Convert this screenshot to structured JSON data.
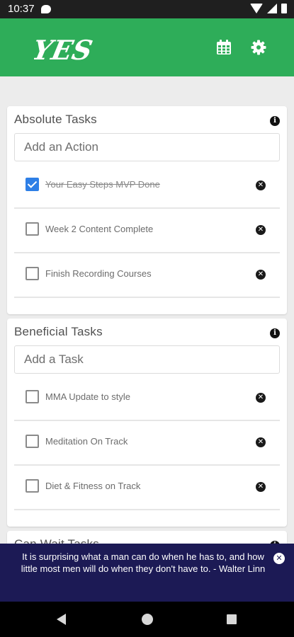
{
  "status_bar": {
    "time": "10:37"
  },
  "app_bar": {
    "logo_text": "YES",
    "accent_color": "#2ead59"
  },
  "sections": [
    {
      "title": "Absolute Tasks",
      "placeholder": "Add an Action",
      "tasks": [
        {
          "label": "Your Easy Steps MVP Done",
          "checked": true
        },
        {
          "label": "Week 2 Content Complete",
          "checked": false
        },
        {
          "label": "Finish Recording Courses",
          "checked": false
        }
      ]
    },
    {
      "title": "Beneficial Tasks",
      "placeholder": "Add a Task",
      "tasks": [
        {
          "label": "MMA Update to style",
          "checked": false
        },
        {
          "label": "Meditation On Track",
          "checked": false
        },
        {
          "label": "Diet & Fitness on Track",
          "checked": false
        }
      ]
    },
    {
      "title": "Can Wait Tasks"
    }
  ],
  "quote": {
    "text": "It is surprising what a man can do when he has to, and how little most men will do when they don't have to. - Walter Linn",
    "background_color": "#1c1a55"
  }
}
